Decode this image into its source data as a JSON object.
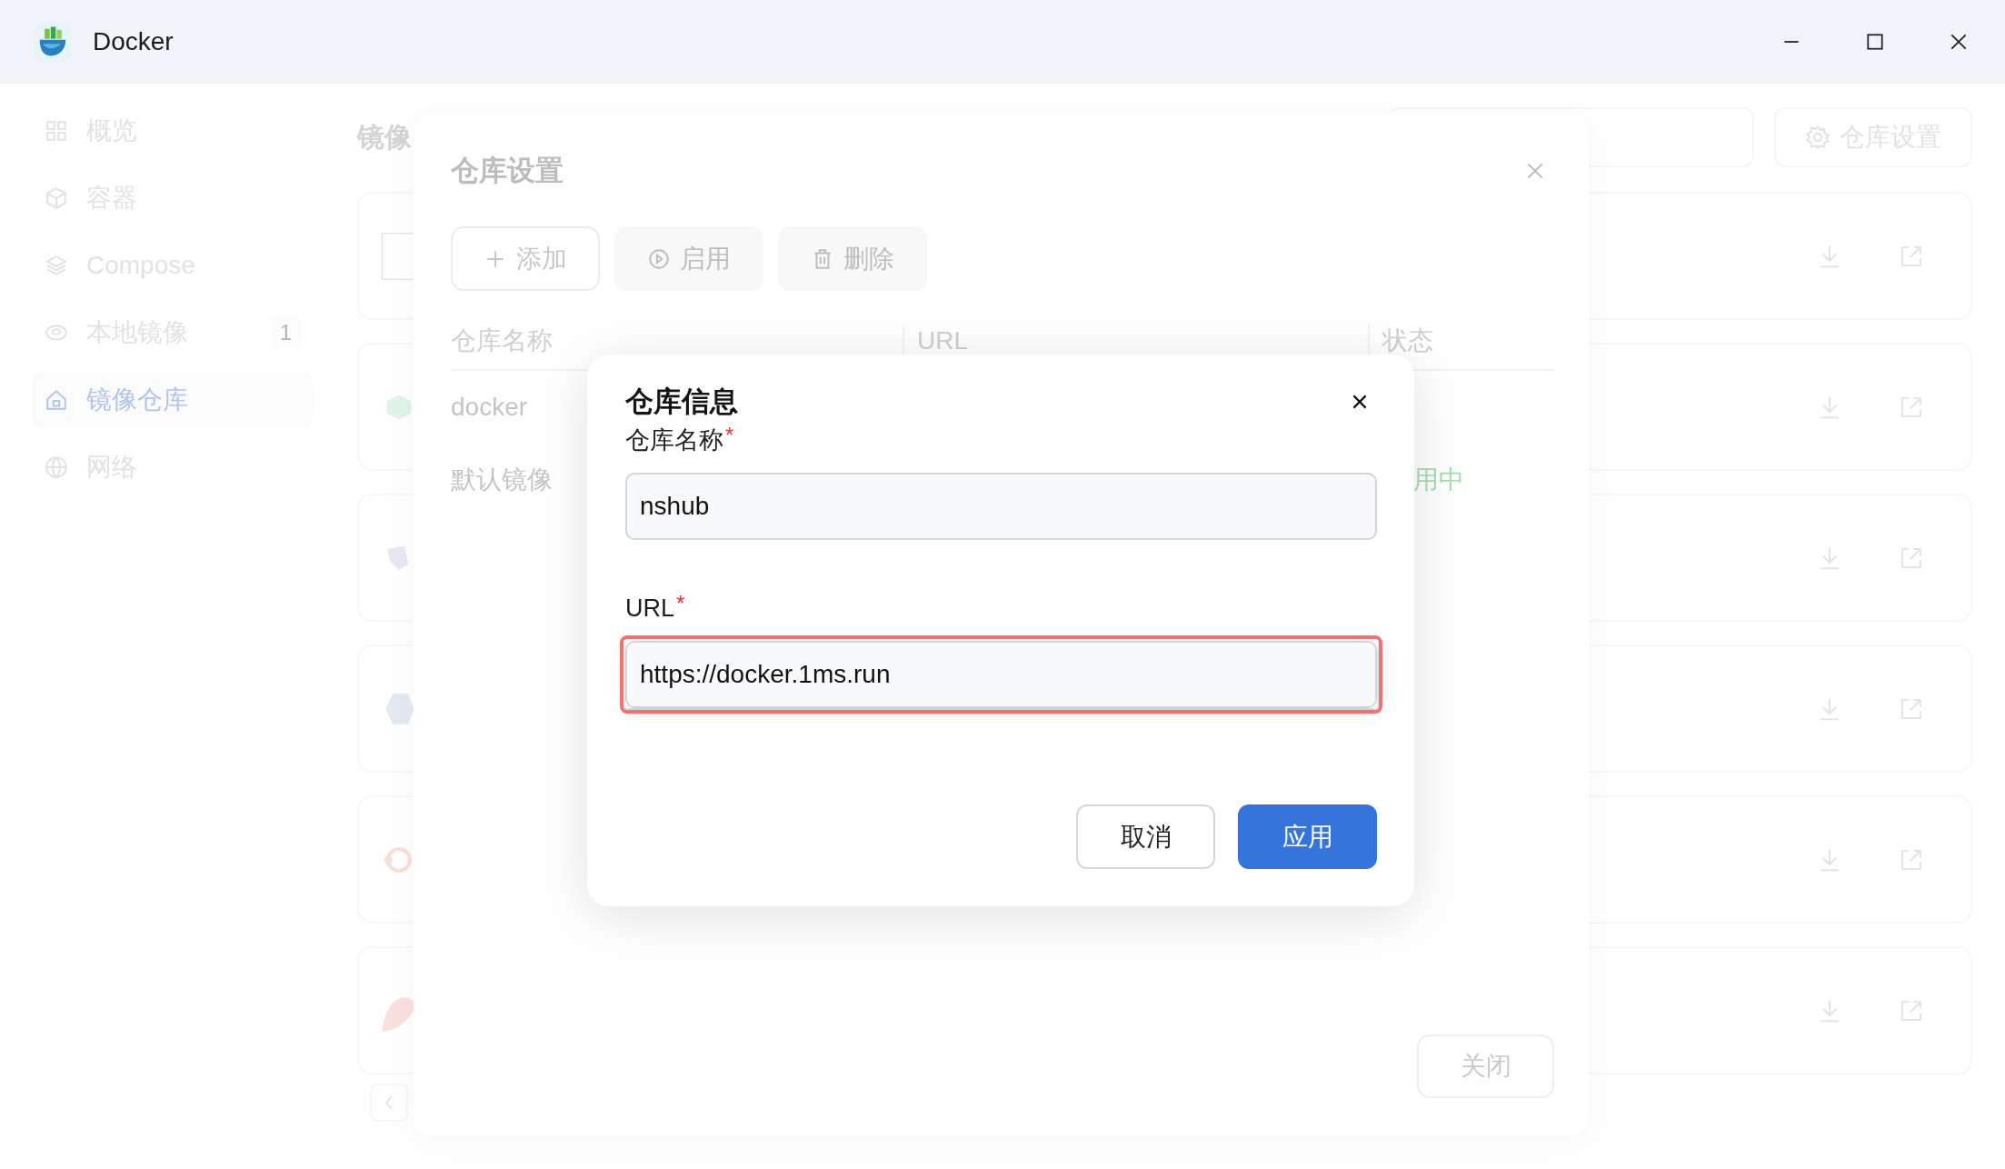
{
  "window": {
    "title": "Docker"
  },
  "sidebar": {
    "items": [
      {
        "label": "概览",
        "selected": false
      },
      {
        "label": "容器",
        "selected": false
      },
      {
        "label": "Compose",
        "selected": false
      },
      {
        "label": "本地镜像",
        "selected": false,
        "badge": "1"
      },
      {
        "label": "镜像仓库",
        "selected": true
      },
      {
        "label": "网络",
        "selected": false
      }
    ]
  },
  "main": {
    "heading": "镜像",
    "settings_button": "仓库设置"
  },
  "settings_dialog": {
    "title": "仓库设置",
    "toolbar": [
      {
        "label": "添加",
        "disabled": false
      },
      {
        "label": "启用",
        "disabled": true
      },
      {
        "label": "删除",
        "disabled": true
      }
    ],
    "columns": [
      "仓库名称",
      "URL",
      "状态"
    ],
    "rows": [
      {
        "name": "docker"
      },
      {
        "name": "默认镜像",
        "status": "用中"
      }
    ],
    "close_button": "关闭"
  },
  "info_dialog": {
    "title": "仓库信息",
    "fields": [
      {
        "label": "仓库名称",
        "required_mark": "*",
        "value": "nshub",
        "highlighted": false
      },
      {
        "label": "URL",
        "required_mark": "*",
        "value": "https://docker.1ms.run",
        "highlighted": true
      }
    ],
    "buttons": [
      {
        "label": "取消",
        "kind": "secondary"
      },
      {
        "label": "应用",
        "kind": "primary"
      }
    ]
  }
}
